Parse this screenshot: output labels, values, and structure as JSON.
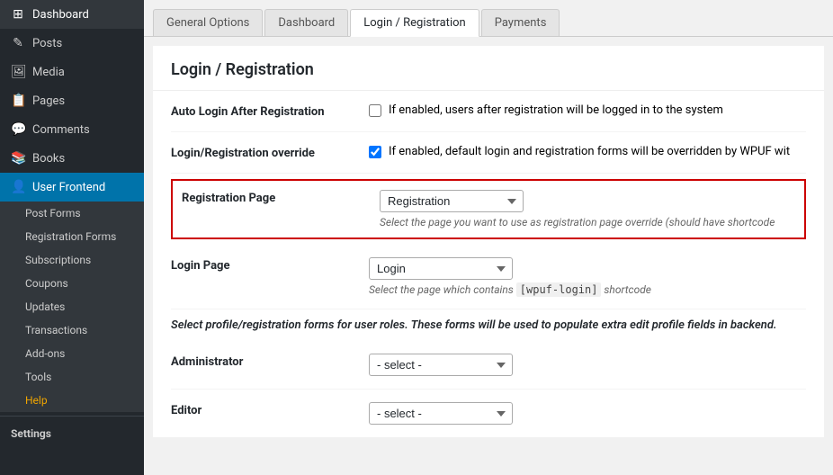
{
  "sidebar": {
    "items": [
      {
        "id": "dashboard",
        "label": "Dashboard",
        "icon": "⊞",
        "active": false
      },
      {
        "id": "posts",
        "label": "Posts",
        "icon": "📄",
        "active": false
      },
      {
        "id": "media",
        "label": "Media",
        "icon": "🖼",
        "active": false
      },
      {
        "id": "pages",
        "label": "Pages",
        "icon": "📋",
        "active": false
      },
      {
        "id": "comments",
        "label": "Comments",
        "icon": "💬",
        "active": false
      },
      {
        "id": "books",
        "label": "Books",
        "icon": "📚",
        "active": false
      },
      {
        "id": "user-frontend",
        "label": "User Frontend",
        "icon": "👤",
        "active": true
      }
    ],
    "subitems": [
      {
        "id": "post-forms",
        "label": "Post Forms",
        "active": false
      },
      {
        "id": "registration-forms",
        "label": "Registration Forms",
        "active": false
      },
      {
        "id": "subscriptions",
        "label": "Subscriptions",
        "active": false
      },
      {
        "id": "coupons",
        "label": "Coupons",
        "active": false
      },
      {
        "id": "updates",
        "label": "Updates",
        "active": false
      },
      {
        "id": "transactions",
        "label": "Transactions",
        "active": false
      },
      {
        "id": "add-ons",
        "label": "Add-ons",
        "active": false
      },
      {
        "id": "tools",
        "label": "Tools",
        "active": false
      },
      {
        "id": "help",
        "label": "Help",
        "active": false
      }
    ],
    "settings_label": "Settings"
  },
  "tabs": [
    {
      "id": "general-options",
      "label": "General Options",
      "active": false
    },
    {
      "id": "dashboard",
      "label": "Dashboard",
      "active": false
    },
    {
      "id": "login-registration",
      "label": "Login / Registration",
      "active": true
    },
    {
      "id": "payments",
      "label": "Payments",
      "active": false
    }
  ],
  "page": {
    "title": "Login / Registration",
    "fields": [
      {
        "id": "auto-login",
        "label": "Auto Login After Registration",
        "type": "checkbox",
        "checked": false,
        "description": "If enabled, users after registration will be logged in to the system"
      },
      {
        "id": "login-override",
        "label": "Login/Registration override",
        "type": "checkbox",
        "checked": true,
        "description": "If enabled, default login and registration forms will be overridden by WPUF wit",
        "highlighted": false
      },
      {
        "id": "registration-page",
        "label": "Registration Page",
        "type": "select",
        "value": "Registration",
        "options": [
          "Registration"
        ],
        "description": "Select the page you want to use as registration page override (should have shortcode",
        "highlighted": true
      },
      {
        "id": "login-page",
        "label": "Login Page",
        "type": "select",
        "value": "Login",
        "options": [
          "Login"
        ],
        "description_parts": [
          {
            "text": "Select the page which contains "
          },
          {
            "code": "[wpuf-login]"
          },
          {
            "text": " shortcode"
          }
        ]
      }
    ],
    "roles_note": "Select profile/registration forms for user roles. These forms will be used to populate extra edit profile fields in backend.",
    "role_fields": [
      {
        "id": "administrator",
        "label": "Administrator",
        "type": "select",
        "value": "- select -",
        "options": [
          "- select -"
        ]
      },
      {
        "id": "editor",
        "label": "Editor",
        "type": "select",
        "value": "- select -",
        "options": [
          "- select -"
        ]
      }
    ]
  }
}
